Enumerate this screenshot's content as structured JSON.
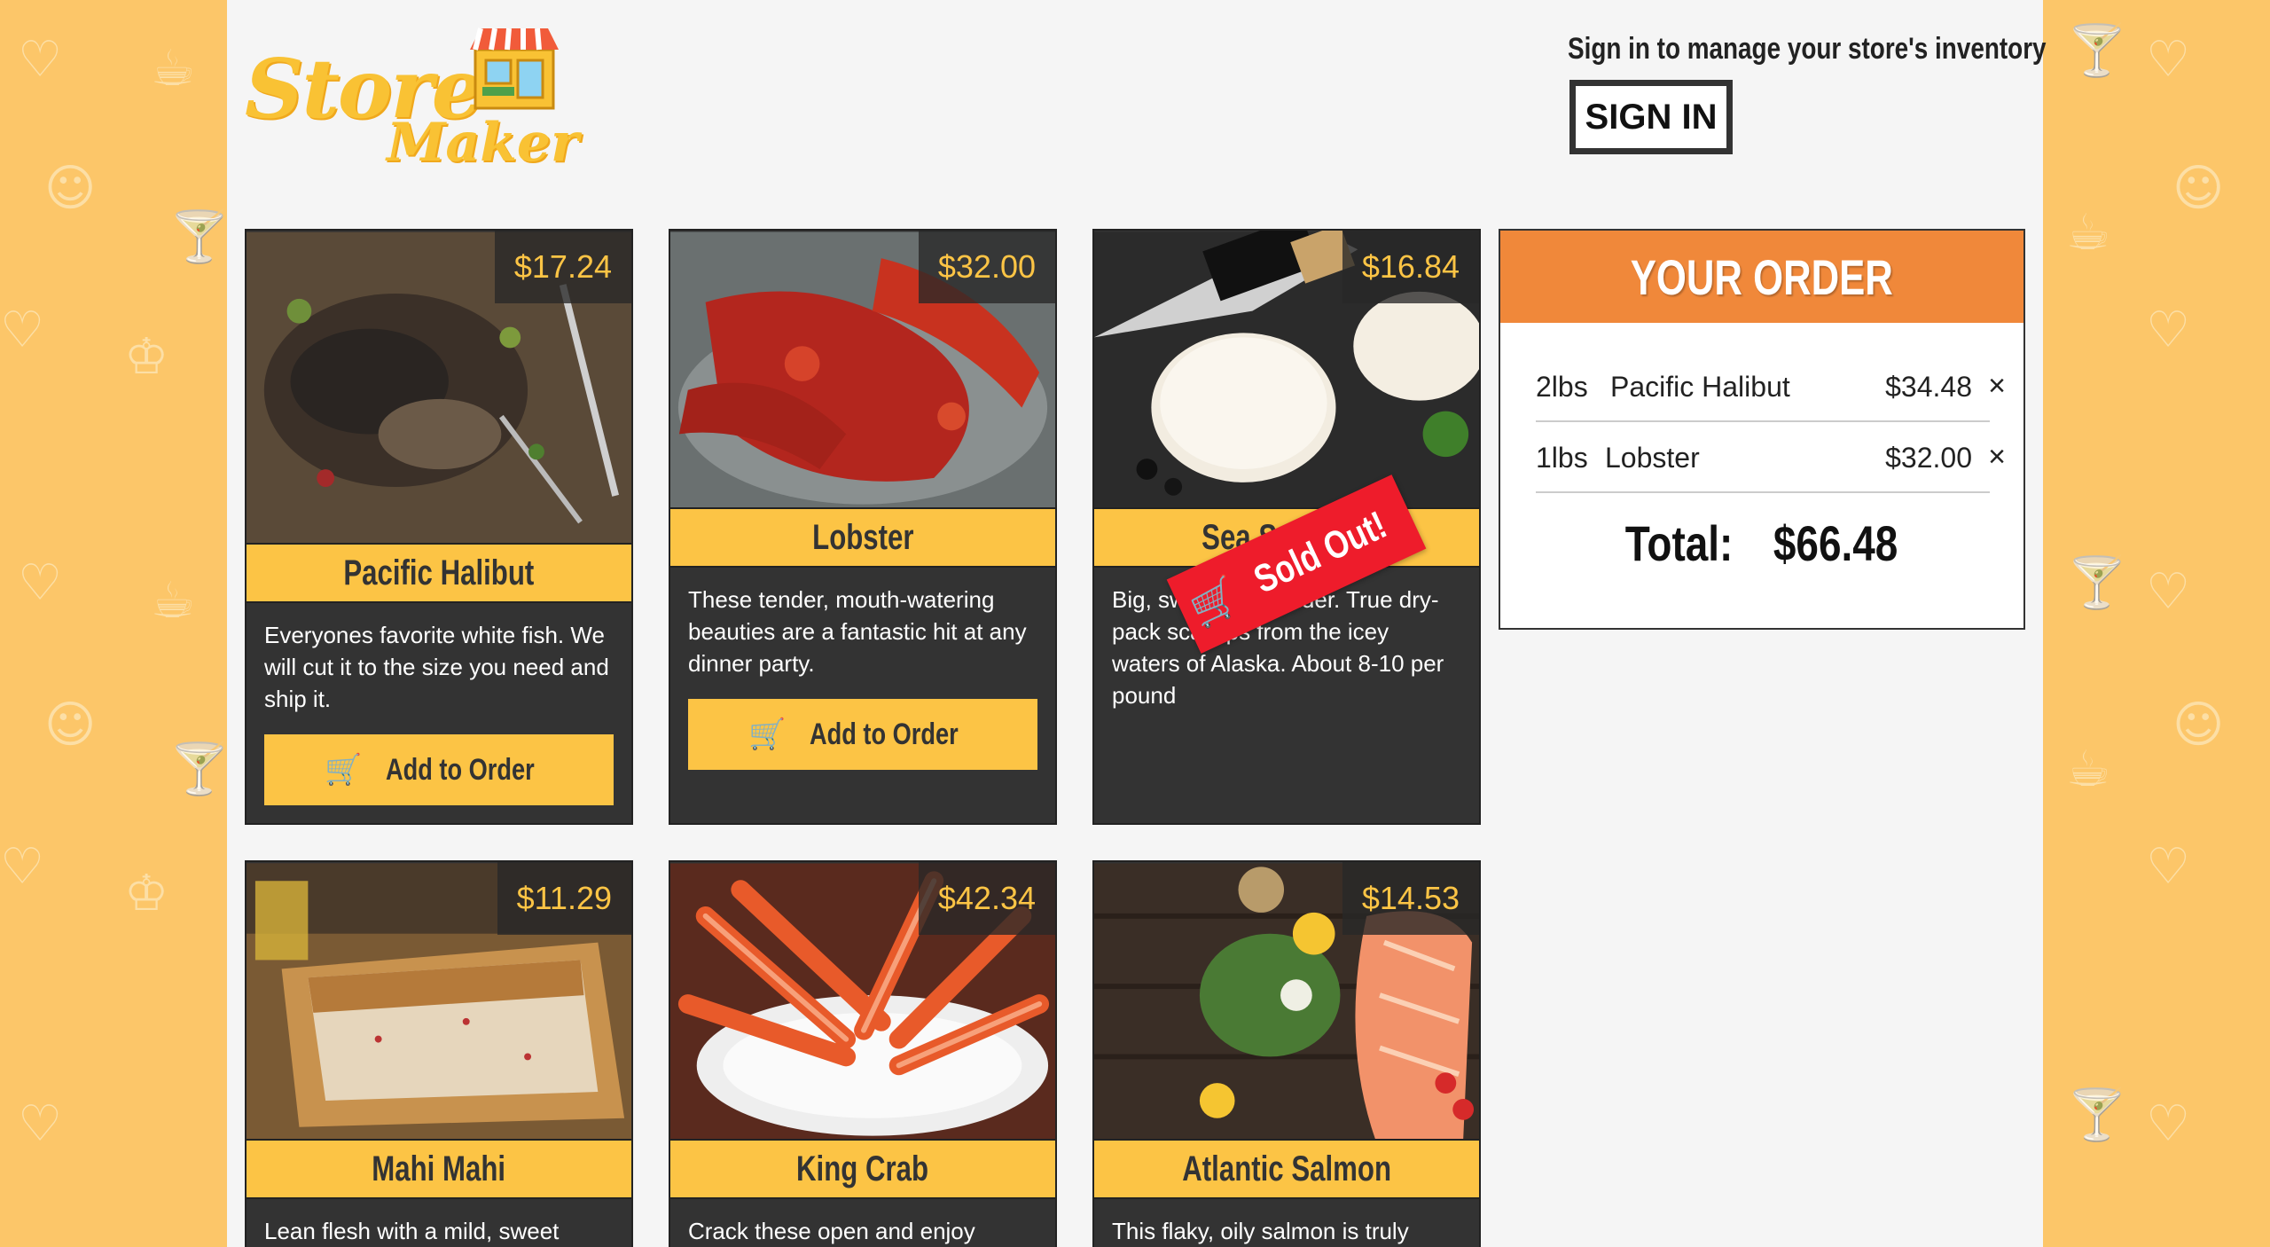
{
  "brand": {
    "logo_line1": "Store",
    "logo_line2": "Maker"
  },
  "header": {
    "signin_prompt": "Sign in to manage your store's inventory",
    "signin_label": "SIGN IN"
  },
  "add_to_order_label": "Add to Order",
  "products": [
    {
      "name": "Pacific Halibut",
      "price": "$17.24",
      "description": "Everyones favorite white fish. We will cut it to the size you need and ship it.",
      "sold_out": false
    },
    {
      "name": "Lobster",
      "price": "$32.00",
      "description": "These tender, mouth-watering beauties are a fantastic hit at any dinner party.",
      "sold_out": false
    },
    {
      "name": "Sea Scallops",
      "price": "$16.84",
      "description": "Big, sweet and tender. True dry-pack scallops from the icey waters of Alaska. About 8-10 per pound",
      "sold_out": true,
      "sold_out_label": "Sold Out!"
    },
    {
      "name": "Mahi Mahi",
      "price": "$11.29",
      "description": "Lean flesh with a mild, sweet",
      "sold_out": false
    },
    {
      "name": "King Crab",
      "price": "$42.34",
      "description": "Crack these open and enjoy",
      "sold_out": false
    },
    {
      "name": "Atlantic Salmon",
      "price": "$14.53",
      "description": "This flaky, oily salmon is truly",
      "sold_out": false
    }
  ],
  "order": {
    "title": "YOUR ORDER",
    "items": [
      {
        "qty": "2lbs",
        "name": "Pacific Halibut",
        "amount": "$34.48",
        "remove": "×"
      },
      {
        "qty": "1lbs",
        "name": "Lobster",
        "amount": "$32.00",
        "remove": "×"
      }
    ],
    "total_label": "Total:",
    "total_amount": "$66.48"
  },
  "colors": {
    "background": "#fcc669",
    "accent_yellow": "#fcc445",
    "order_header": "#f0883a",
    "sold_out_red": "#ee1c2b",
    "card_dark": "#333333"
  }
}
